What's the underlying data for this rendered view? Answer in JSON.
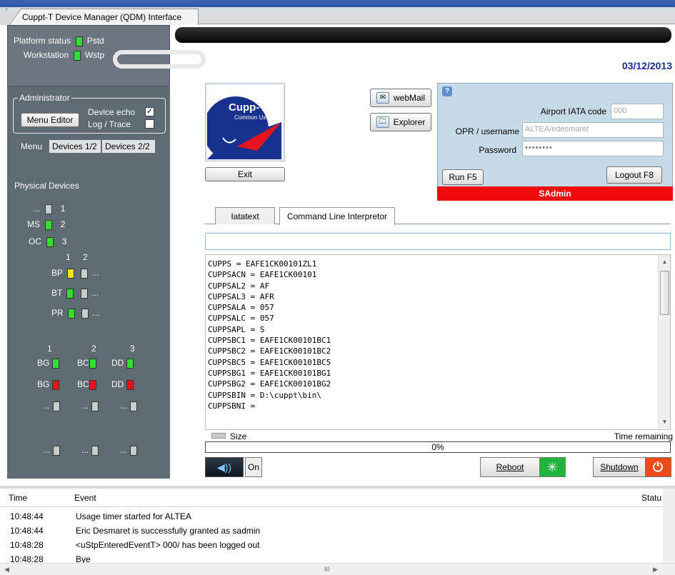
{
  "window": {
    "tab_title": "Cuppt-T Device Manager (QDM) Interface"
  },
  "platform": {
    "platform_status_label": "Platform status",
    "platform_status_code": "Pstd",
    "workstation_label": "Workstation",
    "workstation_code": "Wstp"
  },
  "header": {
    "date": "03/12/2013"
  },
  "admin": {
    "title": "Administrator",
    "menu_editor": "Menu Editor",
    "device_echo": "Device echo",
    "log_trace": "Log / Trace",
    "device_echo_checked": true,
    "log_trace_checked": false
  },
  "left_tabs": [
    "Menu",
    "Devices 1/2",
    "Devices 2/2"
  ],
  "devices": {
    "title": "Physical Devices",
    "rows": [
      {
        "label": "...",
        "num": "1",
        "color": "grey"
      },
      {
        "label": "MS",
        "num": "2",
        "color": "green"
      },
      {
        "label": "OC",
        "num": "3",
        "color": "green"
      }
    ],
    "col_headers": [
      "1",
      "2"
    ],
    "printers": [
      {
        "label": "BP",
        "c1": "yellow",
        "c2": "grey",
        "suffix": "..."
      },
      {
        "label": "BT",
        "c1": "green",
        "c2": "grey",
        "suffix": "..."
      },
      {
        "label": "PR",
        "c1": "green",
        "c2": "grey",
        "suffix": "..."
      }
    ],
    "group_headers": [
      "1",
      "2",
      "3"
    ],
    "group_rows": [
      [
        {
          "label": "BG",
          "color": "green"
        },
        {
          "label": "BC",
          "color": "green"
        },
        {
          "label": "DD",
          "color": "green"
        }
      ],
      [
        {
          "label": "BG",
          "color": "red"
        },
        {
          "label": "BC",
          "color": "red"
        },
        {
          "label": "DD",
          "color": "red"
        }
      ],
      [
        {
          "label": "...",
          "color": "grey"
        },
        {
          "label": "...",
          "color": "grey"
        },
        {
          "label": "...",
          "color": "grey"
        }
      ],
      [
        {
          "label": "...",
          "color": "grey"
        },
        {
          "label": "...",
          "color": "grey"
        },
        {
          "label": "...",
          "color": "grey"
        }
      ]
    ]
  },
  "logo": {
    "title": "Cupp-T",
    "subtitle": "Common Use"
  },
  "buttons": {
    "exit": "Exit",
    "webmail": "webMail",
    "explorer": "Explorer",
    "run": "Run F5",
    "logout": "Logout F8",
    "sound_on": "On",
    "reboot": "Reboot",
    "shutdown": "Shutdown"
  },
  "login": {
    "airport_label": "Airport IATA code",
    "airport_value": "000",
    "user_label": "OPR / username",
    "user_value": "ALTEA/edesmaret",
    "password_label": "Password",
    "password_value": "••••••••",
    "role": "SAdmin"
  },
  "cli_tabs": [
    "Iatatext",
    "Command Line Interpretor"
  ],
  "cli": {
    "input_value": "",
    "output_lines": [
      "CUPPS = EAFE1CK00101ZL1",
      "CUPPSACN = EAFE1CK00101",
      "CUPPSAL2 = AF",
      "CUPPSAL3 = AFR",
      "CUPPSALA = 057",
      "CUPPSALC = 057",
      "CUPPSAPL = S",
      "CUPPSBC1 = EAFE1CK00101BC1",
      "CUPPSBC2 = EAFE1CK00101BC2",
      "CUPPSBC5 = EAFE1CK00101BC5",
      "CUPPSBG1 = EAFE1CK00101BG1",
      "CUPPSBG2 = EAFE1CK00101BG2",
      "CUPPSBIN = D:\\cuppt\\bin\\",
      "CUPPSBNI ="
    ]
  },
  "transfer": {
    "size_label": "Size",
    "time_label": "Time remaining",
    "progress_text": "0%",
    "progress": 0
  },
  "log": {
    "columns": [
      "Time",
      "Event",
      "Statu"
    ],
    "rows": [
      {
        "time": "10:48:44",
        "event": "Usage timer started for ALTEA"
      },
      {
        "time": "10:48:44",
        "event": "Eric Desmaret is successfully granted as sadmin"
      },
      {
        "time": "10:48:28",
        "event": "<uStpEnteredEventT> 000/ has been logged out"
      },
      {
        "time": "10:48:28",
        "event": "Bye"
      }
    ],
    "hscroll_grip": "III"
  },
  "colors": {
    "green": "#33dd33",
    "yellow": "#f2e21b",
    "red": "#e8131f",
    "grey": "#c9cccf",
    "sadmin_bar": "#f00c0c",
    "panel": "#5f6b73"
  }
}
